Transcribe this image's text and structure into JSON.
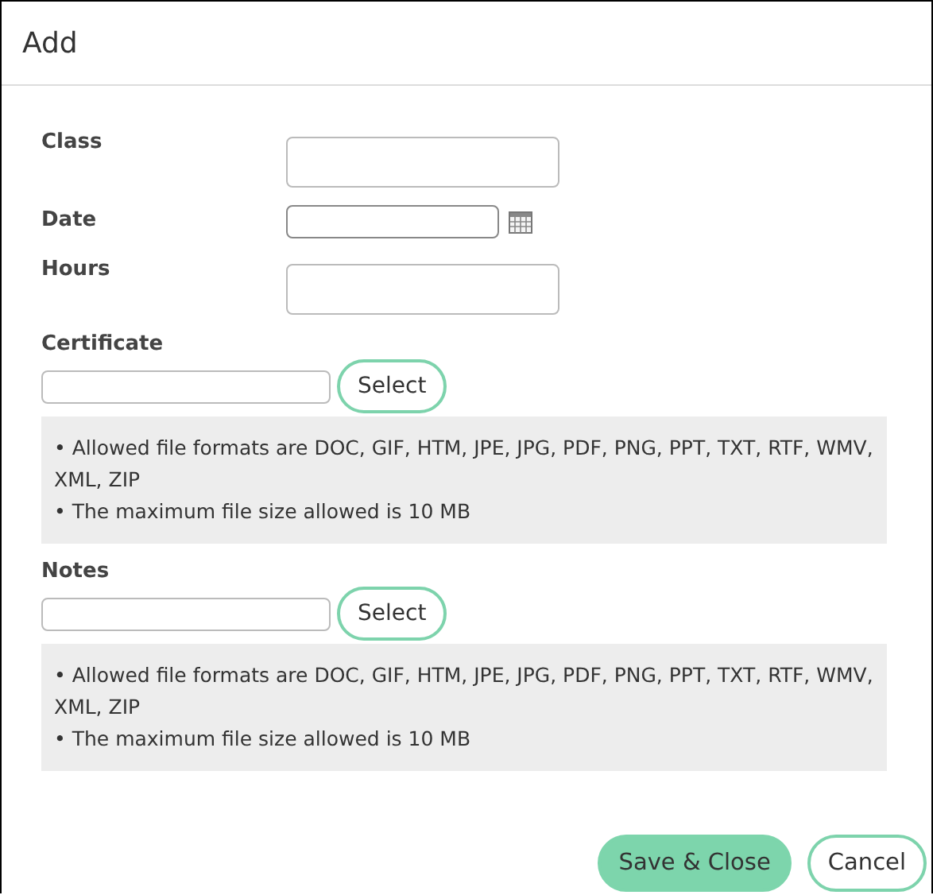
{
  "dialog": {
    "title": "Add"
  },
  "fields": [
    {
      "kind": "text",
      "label": "Class"
    },
    {
      "kind": "date",
      "label": "Date"
    },
    {
      "kind": "text",
      "label": "Hours"
    },
    {
      "kind": "file",
      "label": "Certificate",
      "button": "Select",
      "notes": [
        "• Allowed file formats are DOC, GIF, HTM, JPE, JPG, PDF, PNG, PPT, TXT, RTF, WMV, XML, ZIP",
        "• The maximum file size allowed is 10 MB"
      ]
    },
    {
      "kind": "file",
      "label": "Notes",
      "button": "Select",
      "notes": [
        "• Allowed file formats are DOC, GIF, HTM, JPE, JPG, PDF, PNG, PPT, TXT, RTF, WMV, XML, ZIP",
        "• The maximum file size allowed is 10 MB"
      ]
    }
  ],
  "buttons": [
    {
      "label": "Save & Close",
      "kind": "primary"
    },
    {
      "label": "Cancel",
      "kind": "secondary"
    }
  ]
}
